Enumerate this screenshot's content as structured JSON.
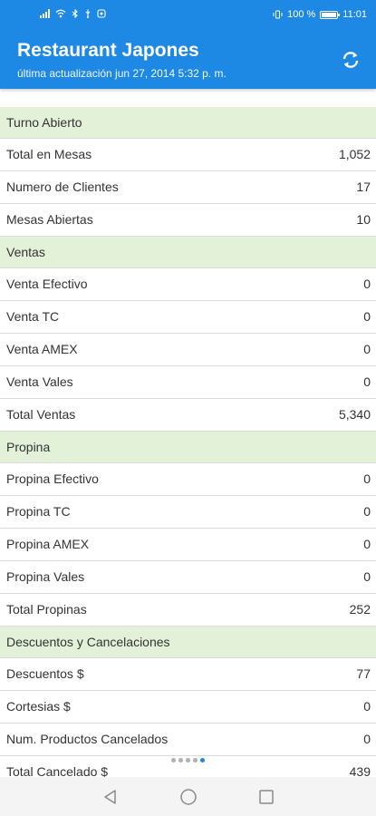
{
  "status_bar": {
    "battery": "100 %",
    "time": "11:01",
    "battery_level": 1.0
  },
  "header": {
    "title": "Restaurant Japones",
    "subtitle": "última actualización jun 27, 2014 5:32 p. m.",
    "refresh_icon": "refresh-icon"
  },
  "sections": [
    {
      "title": "Turno Abierto",
      "rows": [
        {
          "label": "Total en Mesas",
          "value": "1,052"
        },
        {
          "label": "Numero de Clientes",
          "value": "17"
        },
        {
          "label": "Mesas Abiertas",
          "value": "10"
        }
      ]
    },
    {
      "title": "Ventas",
      "rows": [
        {
          "label": "Venta Efectivo",
          "value": "0"
        },
        {
          "label": "Venta TC",
          "value": "0"
        },
        {
          "label": "Venta AMEX",
          "value": "0"
        },
        {
          "label": "Venta Vales",
          "value": "0"
        },
        {
          "label": "Total Ventas",
          "value": "5,340"
        }
      ]
    },
    {
      "title": "Propina",
      "rows": [
        {
          "label": "Propina Efectivo",
          "value": "0"
        },
        {
          "label": "Propina TC",
          "value": "0"
        },
        {
          "label": "Propina AMEX",
          "value": "0"
        },
        {
          "label": "Propina Vales",
          "value": "0"
        },
        {
          "label": "Total Propinas",
          "value": "252"
        }
      ]
    },
    {
      "title": "Descuentos y Cancelaciones",
      "rows": [
        {
          "label": "Descuentos $",
          "value": "77"
        },
        {
          "label": "Cortesias $",
          "value": "0"
        },
        {
          "label": "Num. Productos Cancelados",
          "value": "0"
        },
        {
          "label": "Total Cancelado $",
          "value": "439"
        }
      ]
    }
  ],
  "pager": {
    "count": 5,
    "active_index": 4
  },
  "nav_bar": {
    "back_icon": "back-triangle-icon",
    "home_icon": "home-circle-icon",
    "recents_icon": "recents-square-icon"
  },
  "colors": {
    "primary": "#1e88e5",
    "section_bg": "#e3f1d9",
    "text": "#333333"
  }
}
